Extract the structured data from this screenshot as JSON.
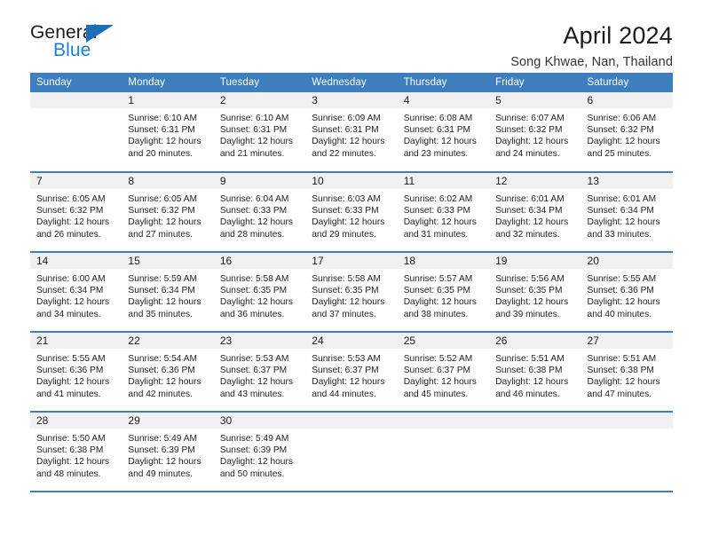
{
  "brand": {
    "line1": "General",
    "line2": "Blue",
    "triangle_icon": "triangle-icon",
    "color_dark": "#1b1b1b",
    "color_blue": "#1c7fd4"
  },
  "header": {
    "title": "April 2024",
    "subtitle": "Song Khwae, Nan, Thailand"
  },
  "theme": {
    "header_blue": "#3d7ebf",
    "daynum_band": "#f0f0f0",
    "text": "#222222"
  },
  "weekdays": [
    "Sunday",
    "Monday",
    "Tuesday",
    "Wednesday",
    "Thursday",
    "Friday",
    "Saturday"
  ],
  "labels": {
    "sunrise": "Sunrise:",
    "sunset": "Sunset:",
    "daylight": "Daylight:"
  },
  "weeks": [
    [
      {
        "day": "",
        "sunrise": "",
        "sunset": "",
        "daylight_a": "",
        "daylight_b": ""
      },
      {
        "day": "1",
        "sunrise": "Sunrise: 6:10 AM",
        "sunset": "Sunset: 6:31 PM",
        "daylight_a": "Daylight: 12 hours",
        "daylight_b": "and 20 minutes."
      },
      {
        "day": "2",
        "sunrise": "Sunrise: 6:10 AM",
        "sunset": "Sunset: 6:31 PM",
        "daylight_a": "Daylight: 12 hours",
        "daylight_b": "and 21 minutes."
      },
      {
        "day": "3",
        "sunrise": "Sunrise: 6:09 AM",
        "sunset": "Sunset: 6:31 PM",
        "daylight_a": "Daylight: 12 hours",
        "daylight_b": "and 22 minutes."
      },
      {
        "day": "4",
        "sunrise": "Sunrise: 6:08 AM",
        "sunset": "Sunset: 6:31 PM",
        "daylight_a": "Daylight: 12 hours",
        "daylight_b": "and 23 minutes."
      },
      {
        "day": "5",
        "sunrise": "Sunrise: 6:07 AM",
        "sunset": "Sunset: 6:32 PM",
        "daylight_a": "Daylight: 12 hours",
        "daylight_b": "and 24 minutes."
      },
      {
        "day": "6",
        "sunrise": "Sunrise: 6:06 AM",
        "sunset": "Sunset: 6:32 PM",
        "daylight_a": "Daylight: 12 hours",
        "daylight_b": "and 25 minutes."
      }
    ],
    [
      {
        "day": "7",
        "sunrise": "Sunrise: 6:05 AM",
        "sunset": "Sunset: 6:32 PM",
        "daylight_a": "Daylight: 12 hours",
        "daylight_b": "and 26 minutes."
      },
      {
        "day": "8",
        "sunrise": "Sunrise: 6:05 AM",
        "sunset": "Sunset: 6:32 PM",
        "daylight_a": "Daylight: 12 hours",
        "daylight_b": "and 27 minutes."
      },
      {
        "day": "9",
        "sunrise": "Sunrise: 6:04 AM",
        "sunset": "Sunset: 6:33 PM",
        "daylight_a": "Daylight: 12 hours",
        "daylight_b": "and 28 minutes."
      },
      {
        "day": "10",
        "sunrise": "Sunrise: 6:03 AM",
        "sunset": "Sunset: 6:33 PM",
        "daylight_a": "Daylight: 12 hours",
        "daylight_b": "and 29 minutes."
      },
      {
        "day": "11",
        "sunrise": "Sunrise: 6:02 AM",
        "sunset": "Sunset: 6:33 PM",
        "daylight_a": "Daylight: 12 hours",
        "daylight_b": "and 31 minutes."
      },
      {
        "day": "12",
        "sunrise": "Sunrise: 6:01 AM",
        "sunset": "Sunset: 6:34 PM",
        "daylight_a": "Daylight: 12 hours",
        "daylight_b": "and 32 minutes."
      },
      {
        "day": "13",
        "sunrise": "Sunrise: 6:01 AM",
        "sunset": "Sunset: 6:34 PM",
        "daylight_a": "Daylight: 12 hours",
        "daylight_b": "and 33 minutes."
      }
    ],
    [
      {
        "day": "14",
        "sunrise": "Sunrise: 6:00 AM",
        "sunset": "Sunset: 6:34 PM",
        "daylight_a": "Daylight: 12 hours",
        "daylight_b": "and 34 minutes."
      },
      {
        "day": "15",
        "sunrise": "Sunrise: 5:59 AM",
        "sunset": "Sunset: 6:34 PM",
        "daylight_a": "Daylight: 12 hours",
        "daylight_b": "and 35 minutes."
      },
      {
        "day": "16",
        "sunrise": "Sunrise: 5:58 AM",
        "sunset": "Sunset: 6:35 PM",
        "daylight_a": "Daylight: 12 hours",
        "daylight_b": "and 36 minutes."
      },
      {
        "day": "17",
        "sunrise": "Sunrise: 5:58 AM",
        "sunset": "Sunset: 6:35 PM",
        "daylight_a": "Daylight: 12 hours",
        "daylight_b": "and 37 minutes."
      },
      {
        "day": "18",
        "sunrise": "Sunrise: 5:57 AM",
        "sunset": "Sunset: 6:35 PM",
        "daylight_a": "Daylight: 12 hours",
        "daylight_b": "and 38 minutes."
      },
      {
        "day": "19",
        "sunrise": "Sunrise: 5:56 AM",
        "sunset": "Sunset: 6:35 PM",
        "daylight_a": "Daylight: 12 hours",
        "daylight_b": "and 39 minutes."
      },
      {
        "day": "20",
        "sunrise": "Sunrise: 5:55 AM",
        "sunset": "Sunset: 6:36 PM",
        "daylight_a": "Daylight: 12 hours",
        "daylight_b": "and 40 minutes."
      }
    ],
    [
      {
        "day": "21",
        "sunrise": "Sunrise: 5:55 AM",
        "sunset": "Sunset: 6:36 PM",
        "daylight_a": "Daylight: 12 hours",
        "daylight_b": "and 41 minutes."
      },
      {
        "day": "22",
        "sunrise": "Sunrise: 5:54 AM",
        "sunset": "Sunset: 6:36 PM",
        "daylight_a": "Daylight: 12 hours",
        "daylight_b": "and 42 minutes."
      },
      {
        "day": "23",
        "sunrise": "Sunrise: 5:53 AM",
        "sunset": "Sunset: 6:37 PM",
        "daylight_a": "Daylight: 12 hours",
        "daylight_b": "and 43 minutes."
      },
      {
        "day": "24",
        "sunrise": "Sunrise: 5:53 AM",
        "sunset": "Sunset: 6:37 PM",
        "daylight_a": "Daylight: 12 hours",
        "daylight_b": "and 44 minutes."
      },
      {
        "day": "25",
        "sunrise": "Sunrise: 5:52 AM",
        "sunset": "Sunset: 6:37 PM",
        "daylight_a": "Daylight: 12 hours",
        "daylight_b": "and 45 minutes."
      },
      {
        "day": "26",
        "sunrise": "Sunrise: 5:51 AM",
        "sunset": "Sunset: 6:38 PM",
        "daylight_a": "Daylight: 12 hours",
        "daylight_b": "and 46 minutes."
      },
      {
        "day": "27",
        "sunrise": "Sunrise: 5:51 AM",
        "sunset": "Sunset: 6:38 PM",
        "daylight_a": "Daylight: 12 hours",
        "daylight_b": "and 47 minutes."
      }
    ],
    [
      {
        "day": "28",
        "sunrise": "Sunrise: 5:50 AM",
        "sunset": "Sunset: 6:38 PM",
        "daylight_a": "Daylight: 12 hours",
        "daylight_b": "and 48 minutes."
      },
      {
        "day": "29",
        "sunrise": "Sunrise: 5:49 AM",
        "sunset": "Sunset: 6:39 PM",
        "daylight_a": "Daylight: 12 hours",
        "daylight_b": "and 49 minutes."
      },
      {
        "day": "30",
        "sunrise": "Sunrise: 5:49 AM",
        "sunset": "Sunset: 6:39 PM",
        "daylight_a": "Daylight: 12 hours",
        "daylight_b": "and 50 minutes."
      },
      {
        "day": "",
        "sunrise": "",
        "sunset": "",
        "daylight_a": "",
        "daylight_b": ""
      },
      {
        "day": "",
        "sunrise": "",
        "sunset": "",
        "daylight_a": "",
        "daylight_b": ""
      },
      {
        "day": "",
        "sunrise": "",
        "sunset": "",
        "daylight_a": "",
        "daylight_b": ""
      },
      {
        "day": "",
        "sunrise": "",
        "sunset": "",
        "daylight_a": "",
        "daylight_b": ""
      }
    ]
  ]
}
